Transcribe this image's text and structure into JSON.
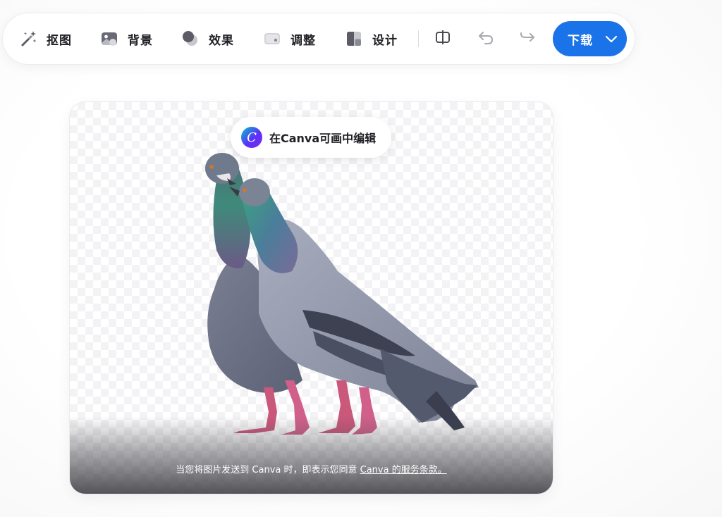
{
  "toolbar": {
    "tools": [
      {
        "label": "抠图",
        "icon": "magic-brush-icon"
      },
      {
        "label": "背景",
        "icon": "image-background-icon"
      },
      {
        "label": "效果",
        "icon": "effects-circles-icon"
      },
      {
        "label": "调整",
        "icon": "adjust-slider-icon"
      },
      {
        "label": "设计",
        "icon": "design-layout-icon"
      }
    ],
    "compare_icon": "compare-split-icon",
    "undo_icon": "undo-icon",
    "redo_icon": "redo-icon",
    "download_label": "下载",
    "download_chevron_icon": "chevron-down-icon",
    "accent_color": "#1a73e8"
  },
  "canvas": {
    "edit_in_canva_label": "在Canva可画中编辑",
    "canva_logo_letter": "C",
    "consent_prefix": "当您将图片发送到 Canva 时，即表示您同意 ",
    "consent_link": "Canva 的服务条款。",
    "subject": "two pigeons"
  }
}
